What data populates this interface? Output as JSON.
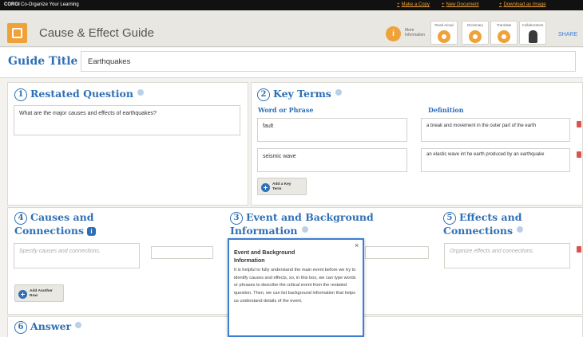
{
  "topbar": {
    "brand": "CORGI",
    "subtitle": "Co-Organize Your Learning",
    "links": [
      "Make a Copy",
      "New Document",
      "Download as Image"
    ]
  },
  "header": {
    "title": "Cause & Effect Guide",
    "more_info_label": "More Information",
    "tools": [
      "Read Aloud",
      "Dictionary",
      "Translate",
      "Collaborators"
    ],
    "share": "SHARE"
  },
  "guide": {
    "label": "Guide Title",
    "value": "Earthquakes"
  },
  "restated_question": {
    "number": "1",
    "title": "Restated Question",
    "value": "What are the major causes and effects of earthquakes?"
  },
  "key_terms": {
    "number": "2",
    "title": "Key Terms",
    "col_word": "Word or Phrase",
    "col_definition": "Definition",
    "rows": [
      {
        "term": "fault",
        "definition": "a break and movement in the outer part of the earth"
      },
      {
        "term": "seismic wave",
        "definition": "an elastic wave int he earth produced by an earthquake"
      }
    ],
    "add_button": "Add a Key Term"
  },
  "causes": {
    "number": "4",
    "title_line1": "Causes and",
    "title_line2": "Connections",
    "placeholder": "Specify causes and connections."
  },
  "event": {
    "number": "3",
    "title_line1": "Event and Background",
    "title_line2": "Information"
  },
  "effects": {
    "number": "5",
    "title_line1": "Effects and",
    "title_line2": "Connections",
    "placeholder": "Organize effects and connections."
  },
  "add_row_button": "Add Another Row",
  "answer": {
    "number": "6",
    "title": "Answer"
  },
  "popup": {
    "title": "Event and Background Information",
    "body": "It is helpful to fully understand the main event before we try to identify causes and effects, so, in this box, we can type words or phrases to describe the critical event from the restated question. Then, we can list background information that helps us understand details of the event.",
    "close": "×"
  },
  "colors": {
    "accent": "#f0a23a",
    "heading_blue": "#2e6fb5",
    "background": "#f3f2ee"
  }
}
